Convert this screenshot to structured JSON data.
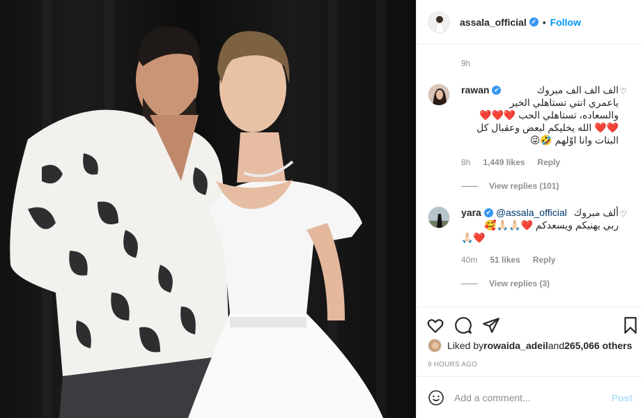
{
  "header": {
    "username": "assala_official",
    "verified_mark": "✔",
    "separator": "•",
    "follow_label": "Follow"
  },
  "post_time": "9h",
  "comments": [
    {
      "username": "rawan",
      "lines": [
        "الف الف الف مبروك",
        "ياعمري انتي تستاهلي الخير",
        "والسعاده، تستاهلي الحب ❤️❤️❤️",
        "❤️❤️ الله يخليكم لبعض وعقبال كل",
        "البنات وانا اوّلهم 🤣😜"
      ],
      "time": "8h",
      "likes": "1,449 likes",
      "reply_label": "Reply",
      "view_replies": "View replies (101)"
    },
    {
      "username": "yara",
      "mention": "@assala_official",
      "lines": [
        "ألف مبروك",
        "ربي يهنيكم ويسعدكم ❤️🙏🏻🙏🏻🥰",
        "🙏🏻❤️"
      ],
      "time": "40m",
      "likes": "51 likes",
      "reply_label": "Reply",
      "view_replies": "View replies (3)"
    }
  ],
  "likes_line": {
    "prefix": "Liked by ",
    "user": "rowaida_adeil",
    "and": " and ",
    "count": "265,066 others"
  },
  "ago": "9 HOURS AGO",
  "add_comment": {
    "placeholder": "Add a comment...",
    "post_label": "Post"
  },
  "icons": {
    "like": "heart-icon",
    "comment": "comment-icon",
    "share": "share-icon",
    "save": "bookmark-icon",
    "emoji": "smiley-icon"
  },
  "colors": {
    "link": "#0095f6",
    "verified": "#3897f0",
    "muted": "#8e8e8e",
    "post_disabled": "#b2dffc"
  }
}
